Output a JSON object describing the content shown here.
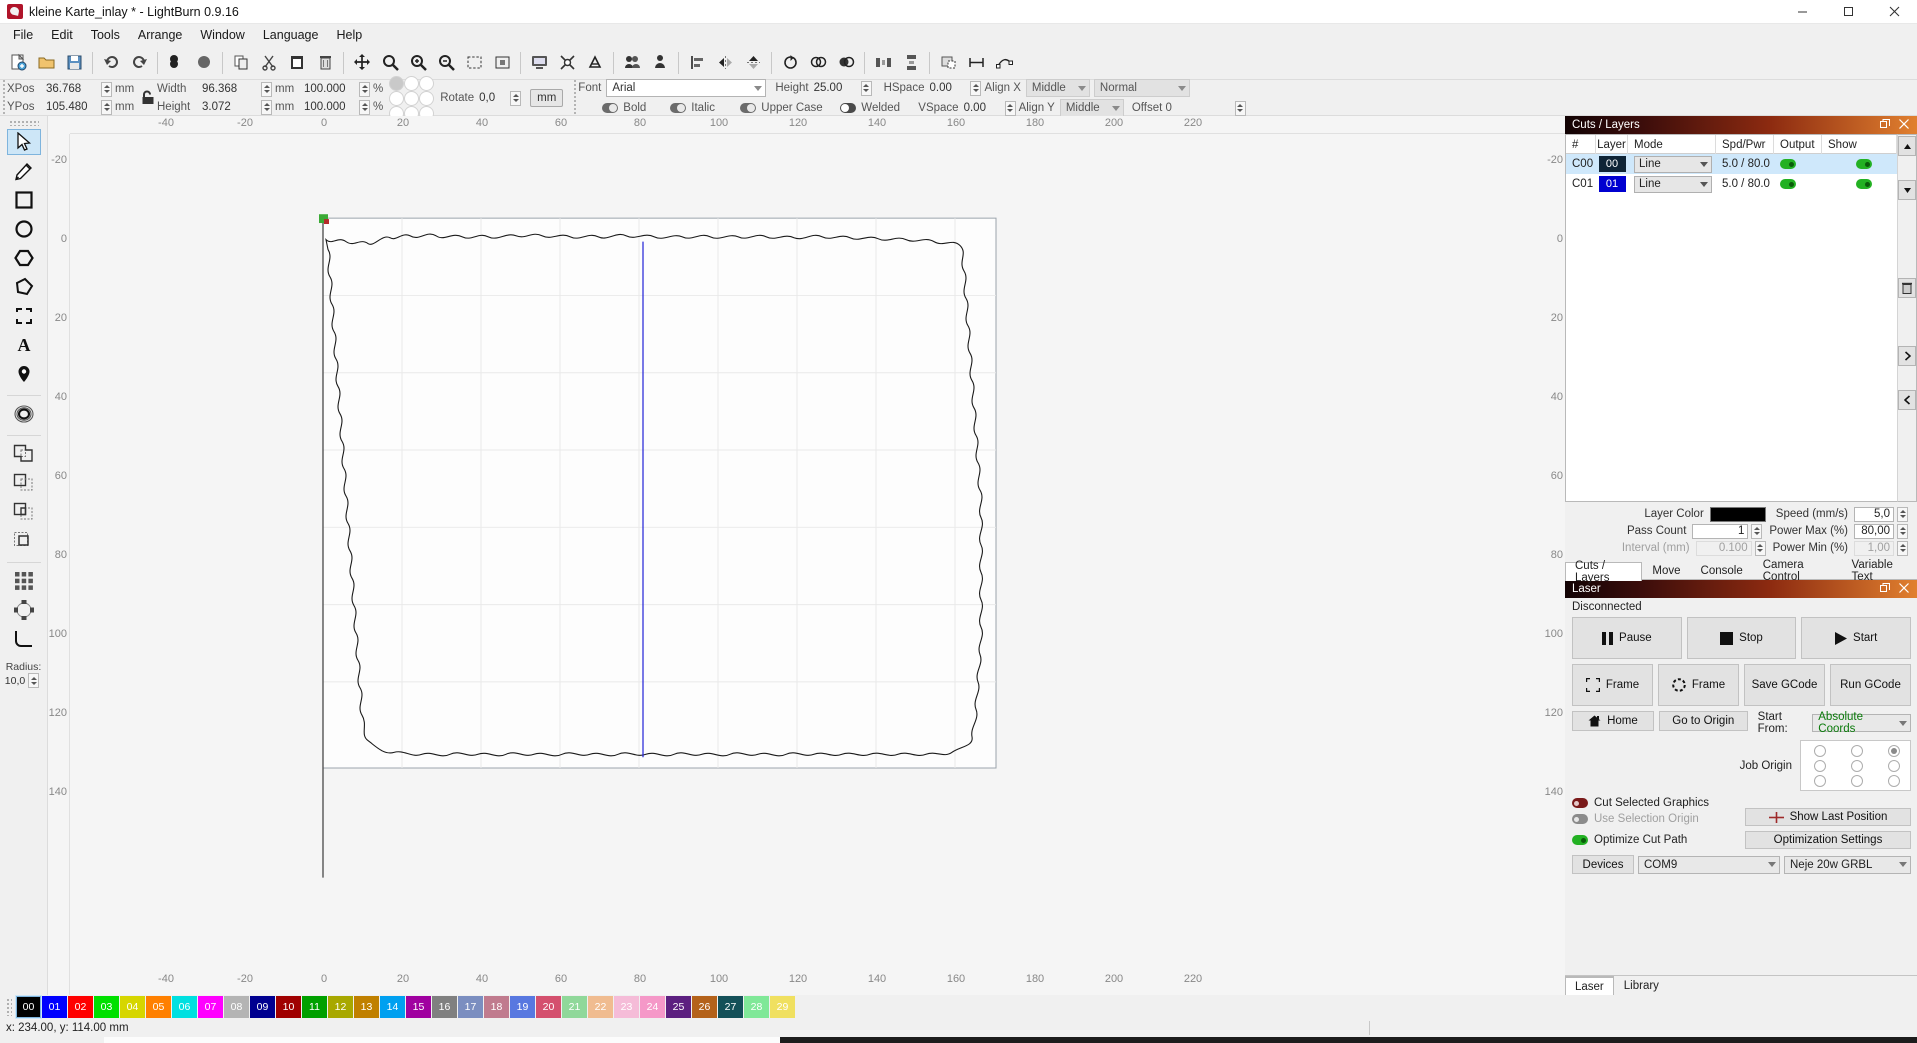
{
  "window": {
    "title": "kleine Karte_inlay * - LightBurn 0.9.16",
    "app_icon": "lightburn-logo-icon",
    "minimize": "–",
    "maximize": "▢",
    "close": "✕"
  },
  "menubar": {
    "items": [
      "File",
      "Edit",
      "Tools",
      "Arrange",
      "Window",
      "Language",
      "Help"
    ]
  },
  "toolbar": {
    "groups": [
      [
        "new-file-icon",
        "open-file-icon",
        "save-file-icon"
      ],
      [
        "undo-icon",
        "redo-icon",
        "cut-icon",
        "copy-icon",
        "paste-icon",
        "delete-icon"
      ],
      [
        "move-icon",
        "zoom-to-selection-icon",
        "zoom-in-icon",
        "zoom-out-icon",
        "frame-selection-icon",
        "fit-to-view-icon"
      ],
      [
        "preview-icon",
        "print-and-cut-icon",
        "material-test-icon",
        "tools-icon"
      ],
      [
        "group-icon",
        "ungroup-icon"
      ],
      [
        "mirror-horizontal-icon",
        "mirror-vertical-icon",
        "rotate-icon"
      ],
      [
        "align-center-icon",
        "align-left-icon",
        "align-right-icon"
      ],
      [
        "distribute-horizontal-icon",
        "distribute-vertical-icon"
      ],
      [
        "snap-to-grid-icon",
        "measure-icon",
        "node-edit-icon"
      ]
    ]
  },
  "properties": {
    "xpos": {
      "label": "XPos",
      "value": "36.768",
      "unit": "mm"
    },
    "ypos": {
      "label": "YPos",
      "value": "105.480",
      "unit": "mm"
    },
    "width": {
      "label": "Width",
      "value": "96.368",
      "unit": "mm",
      "percent": "100.000",
      "percent_unit": "%"
    },
    "height": {
      "label": "Height",
      "value": "3.072",
      "unit": "mm",
      "percent": "100.000",
      "percent_unit": "%"
    },
    "lock_icon": "unlocked-icon",
    "anchor_name": "position-anchor-grid",
    "rotate": {
      "label": "Rotate",
      "value": "0,0"
    },
    "units_button": "mm",
    "font": {
      "label": "Font",
      "value": "Arial"
    },
    "text_height": {
      "label": "Height",
      "value": "25.00"
    },
    "hspace": {
      "label": "HSpace",
      "value": "0.00"
    },
    "vspace": {
      "label": "VSpace",
      "value": "0.00"
    },
    "align_x": {
      "label": "Align X",
      "value": "Middle"
    },
    "align_y": {
      "label": "Align Y",
      "value": "Middle"
    },
    "weld_mode": {
      "value": "Normal"
    },
    "offset": {
      "label": "Offset 0"
    },
    "bold": "Bold",
    "italic": "Italic",
    "upper_case": "Upper Case",
    "welded": "Welded"
  },
  "tools_sidebar": {
    "items": [
      {
        "name": "select-tool",
        "icon": "cursor-arrow-icon",
        "active": true
      },
      {
        "name": "draw-lines-tool",
        "icon": "pencil-icon",
        "active": false
      },
      {
        "name": "rectangle-tool",
        "icon": "square-icon",
        "active": false
      },
      {
        "name": "ellipse-tool",
        "icon": "circle-icon",
        "active": false
      },
      {
        "name": "polygon-tool",
        "icon": "hexagon-icon",
        "active": false
      },
      {
        "name": "edit-nodes-tool",
        "icon": "polygon-nodes-icon",
        "active": false
      },
      {
        "name": "trim-tool",
        "icon": "trim-corners-icon",
        "active": false
      },
      {
        "name": "text-tool",
        "icon": "letter-a-icon",
        "active": false
      },
      {
        "name": "position-tool",
        "icon": "map-pin-icon",
        "active": false
      },
      {
        "name": "offset-shapes-tool",
        "icon": "concentric-rings-icon",
        "active": false
      },
      {
        "name": "boolean-union-tool",
        "icon": "boolean-union-icon",
        "active": false
      },
      {
        "name": "boolean-subtract-tool",
        "icon": "boolean-subtract-icon",
        "active": false
      },
      {
        "name": "boolean-intersect-tool",
        "icon": "boolean-intersect-icon",
        "active": false
      },
      {
        "name": "boolean-cut-tool",
        "icon": "boolean-cut-icon",
        "active": false
      },
      {
        "name": "array-tool",
        "icon": "grid-array-icon",
        "active": false
      },
      {
        "name": "circular-array-tool",
        "icon": "circular-array-icon",
        "active": false
      },
      {
        "name": "radius-tool",
        "icon": "fillet-radius-icon",
        "active": false
      }
    ],
    "radius": {
      "label": "Radius:",
      "value": "10,0"
    }
  },
  "canvas": {
    "h_ruler_top": [
      "-40",
      "-20",
      "0",
      "20",
      "40",
      "60",
      "80",
      "100",
      "120",
      "140",
      "160",
      "180",
      "200",
      "220"
    ],
    "h_ruler_bottom": [
      "-40",
      "-20",
      "0",
      "20",
      "40",
      "60",
      "80",
      "100",
      "120",
      "140",
      "160",
      "180",
      "200",
      "220"
    ],
    "v_ruler_left": [
      "-20",
      "0",
      "20",
      "40",
      "60",
      "80",
      "100",
      "120",
      "140"
    ],
    "v_ruler_right": [
      "-20",
      "0",
      "20",
      "40",
      "60",
      "80",
      "100",
      "120",
      "140"
    ],
    "workpiece_name": "puzzle-inlay-outline",
    "origin_marker": "origin-handle",
    "guide_line": "vertical-guide-line"
  },
  "cuts_layers": {
    "title": "Cuts / Layers",
    "columns": [
      "#",
      "Layer",
      "Mode",
      "Spd/Pwr",
      "Output",
      "Show"
    ],
    "rows": [
      {
        "num": "C00",
        "layer": "00",
        "layer_color": "#000000",
        "mode": "Line",
        "spd_pwr": "5.0 / 80.0",
        "output": true,
        "show": true,
        "selected": true
      },
      {
        "num": "C01",
        "layer": "01",
        "layer_color": "#0000d0",
        "mode": "Line",
        "spd_pwr": "5.0 / 80.0",
        "output": true,
        "show": true,
        "selected": false
      }
    ],
    "settings": {
      "layer_color_label": "Layer Color",
      "layer_color_value": "#000000",
      "speed_label": "Speed (mm/s)",
      "speed_value": "5,0",
      "pass_count_label": "Pass Count",
      "pass_count_value": "1",
      "power_max_label": "Power Max (%)",
      "power_max_value": "80,00",
      "interval_label": "Interval (mm)",
      "interval_value": "0.100",
      "power_min_label": "Power Min (%)",
      "power_min_value": "1,00"
    },
    "scroll_buttons": [
      "scroll-up-icon",
      "scroll-down-icon",
      "delete-icon",
      "move-right-icon",
      "move-left-icon"
    ]
  },
  "dock_tabs": {
    "items": [
      "Cuts / Layers",
      "Move",
      "Console",
      "Camera Control",
      "Variable Text"
    ],
    "active": "Cuts / Layers"
  },
  "laser": {
    "title": "Laser",
    "status": "Disconnected",
    "pause": "Pause",
    "stop": "Stop",
    "start": "Start",
    "frame": "Frame",
    "rotary_frame": "Frame",
    "save_gcode": "Save GCode",
    "run_gcode": "Run GCode",
    "home": "Home",
    "go_to_origin": "Go to Origin",
    "start_from_label": "Start From:",
    "start_from_value": "Absolute Coords",
    "job_origin_label": "Job Origin",
    "job_origin_selected_index": 2,
    "cut_selected_graphics": "Cut Selected Graphics",
    "use_selection_origin": "Use Selection Origin",
    "show_last_position": "Show Last Position",
    "optimize_cut_path": "Optimize Cut Path",
    "optimization_settings": "Optimization Settings",
    "devices": "Devices",
    "port": "COM9",
    "device_profile": "Neje 20w GRBL",
    "toggles": {
      "cut_selected_graphics": "on-red",
      "use_selection_origin": "off-grey",
      "optimize_cut_path": "on-green"
    }
  },
  "bottom_tabs": {
    "items": [
      "Laser",
      "Library"
    ],
    "active": "Laser"
  },
  "palette": {
    "swatches": [
      {
        "index": "00",
        "color": "#000000"
      },
      {
        "index": "01",
        "color": "#0000ff"
      },
      {
        "index": "02",
        "color": "#ff0000"
      },
      {
        "index": "03",
        "color": "#00e000"
      },
      {
        "index": "04",
        "color": "#d6d600"
      },
      {
        "index": "05",
        "color": "#ff8000"
      },
      {
        "index": "06",
        "color": "#00e0e0"
      },
      {
        "index": "07",
        "color": "#ff00ff"
      },
      {
        "index": "08",
        "color": "#b4b4b4"
      },
      {
        "index": "09",
        "color": "#000090"
      },
      {
        "index": "10",
        "color": "#a00000"
      },
      {
        "index": "11",
        "color": "#00a000"
      },
      {
        "index": "12",
        "color": "#a8a800"
      },
      {
        "index": "13",
        "color": "#c08000"
      },
      {
        "index": "14",
        "color": "#00a0f0"
      },
      {
        "index": "15",
        "color": "#a000a0"
      },
      {
        "index": "16",
        "color": "#808080"
      },
      {
        "index": "17",
        "color": "#7b8ec0"
      },
      {
        "index": "18",
        "color": "#c07b8e"
      },
      {
        "index": "19",
        "color": "#5878e0"
      },
      {
        "index": "20",
        "color": "#d4506e"
      },
      {
        "index": "21",
        "color": "#90d89a"
      },
      {
        "index": "22",
        "color": "#f0bc90"
      },
      {
        "index": "23",
        "color": "#f5bcd8"
      },
      {
        "index": "24",
        "color": "#f598c8"
      },
      {
        "index": "25",
        "color": "#5c2080"
      },
      {
        "index": "26",
        "color": "#b4621a"
      },
      {
        "index": "27",
        "color": "#145058"
      },
      {
        "index": "28",
        "color": "#80e898"
      },
      {
        "index": "29",
        "color": "#f0e060"
      }
    ]
  },
  "statusbar": {
    "coords": "x: 234.00, y: 114.00 mm"
  }
}
